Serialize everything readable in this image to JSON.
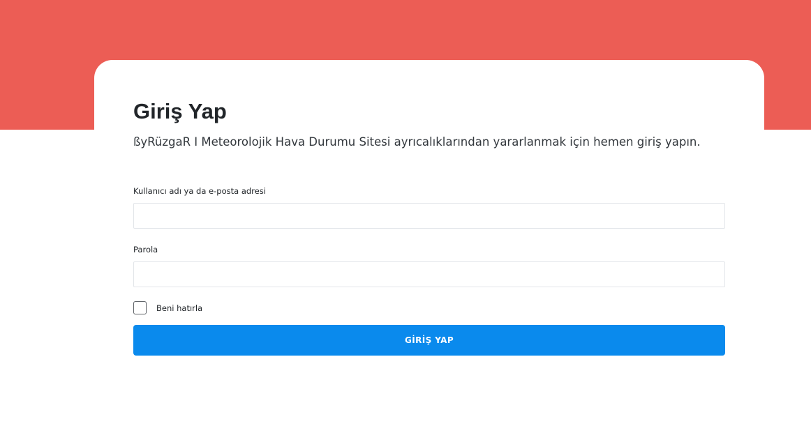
{
  "colors": {
    "banner": "#ec5d55",
    "card": "#ffffff",
    "primary_button": "#0a8aed",
    "input_border": "#e2e5e9"
  },
  "login": {
    "title": "Giriş Yap",
    "subtitle": "ßyRüzgaR I Meteorolojik Hava Durumu Sitesi ayrıcalıklarından yararlanmak için hemen giriş yapın.",
    "username_label": "Kullanıcı adı ya da e-posta adresi",
    "username_value": "",
    "password_label": "Parola",
    "password_value": "",
    "remember_label": "Beni hatırla",
    "remember_checked": false,
    "submit_label": "GİRİŞ YAP"
  }
}
